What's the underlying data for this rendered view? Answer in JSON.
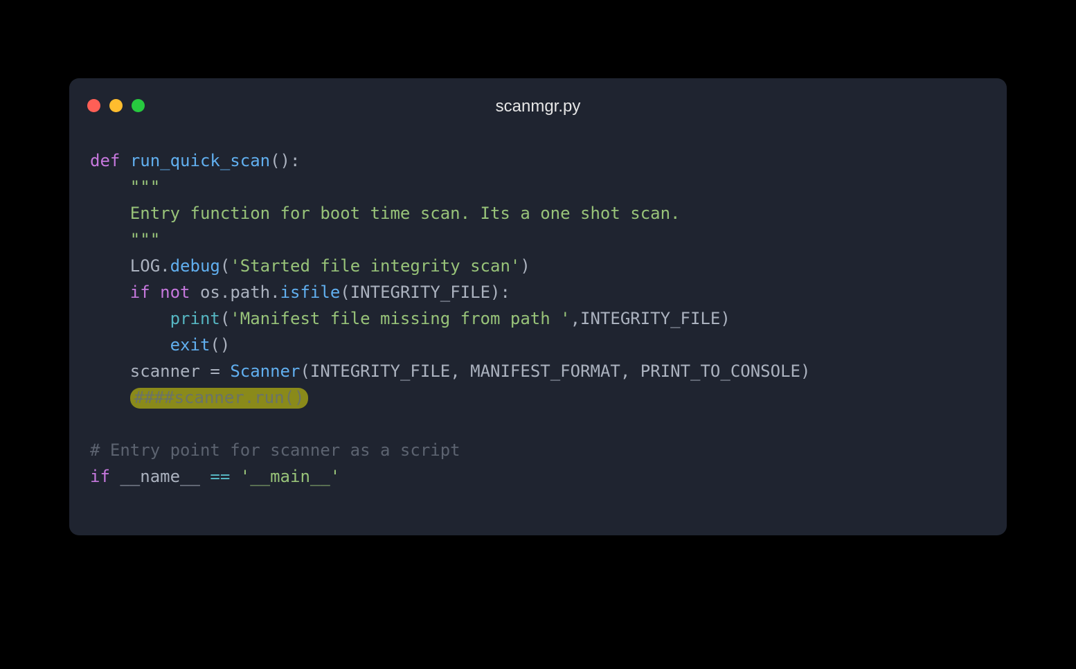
{
  "window": {
    "title": "scanmgr.py"
  },
  "code": {
    "l1_def": "def",
    "l1_fn": "run_quick_scan",
    "l1_tail": "():",
    "l2": "\"\"\"",
    "l3": "Entry function for boot time scan. Its a one shot scan.",
    "l4": "\"\"\"",
    "l5_log": "LOG",
    "l5_dot1": ".",
    "l5_debug": "debug",
    "l5_open": "(",
    "l5_str": "'Started file integrity scan'",
    "l5_close": ")",
    "l6_if": "if",
    "l6_not": "not",
    "l6_os": "os",
    "l6_dot1": ".",
    "l6_path": "path",
    "l6_dot2": ".",
    "l6_isfile": "isfile",
    "l6_open": "(",
    "l6_arg": "INTEGRITY_FILE",
    "l6_close": "):",
    "l7_print": "print",
    "l7_open": "(",
    "l7_str": "'Manifest file missing from path '",
    "l7_comma": ",",
    "l7_arg": "INTEGRITY_FILE",
    "l7_close": ")",
    "l8_exit": "exit",
    "l8_parens": "()",
    "l9_scanner": "scanner",
    "l9_eq": " = ",
    "l9_Scanner": "Scanner",
    "l9_open": "(",
    "l9_a1": "INTEGRITY_FILE",
    "l9_c1": ", ",
    "l9_a2": "MANIFEST_FORMAT",
    "l9_c2": ", ",
    "l9_a3": "PRINT_TO_CONSOLE",
    "l9_close": ")",
    "l10_hashes": "####",
    "l10_rest": "scanner.run()",
    "l12_comment": "# Entry point for scanner as a script",
    "l13_if": "if",
    "l13_name": "__name__",
    "l13_eq": " == ",
    "l13_main": "'__main__'"
  }
}
